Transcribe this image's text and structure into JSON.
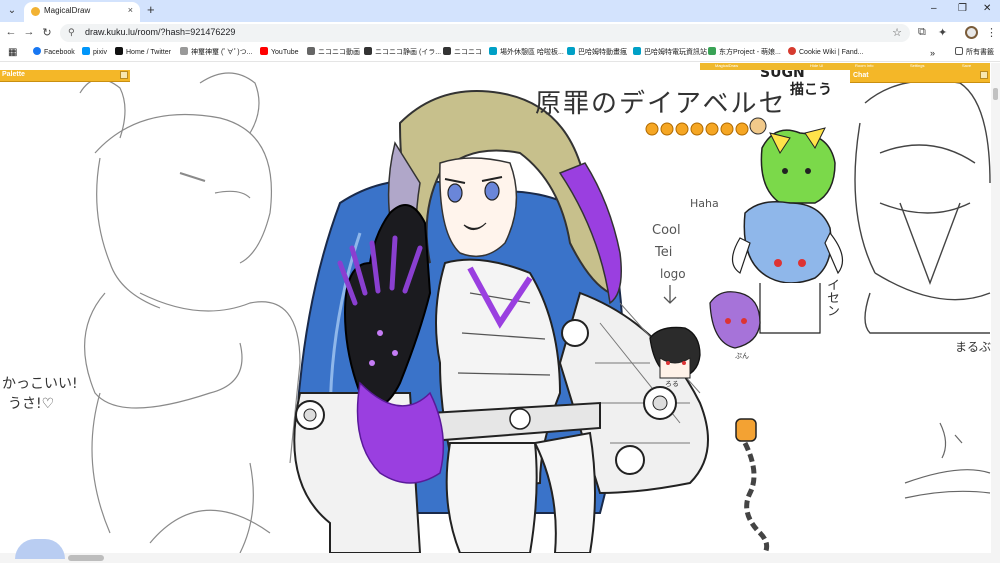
{
  "browser": {
    "tab_title": "MagicalDraw",
    "tab_close": "×",
    "new_tab": "+",
    "tab_menu": "⌄",
    "window_controls": {
      "minimize": "–",
      "maximize": "❐",
      "close": "✕"
    },
    "nav": {
      "back": "←",
      "forward": "→",
      "reload": "↻"
    },
    "site_info_icon": "⚲",
    "url": "draw.kuku.lu/room/?hash=921476229",
    "bookmark_star": "☆",
    "extensions": [
      "⧉",
      "✦",
      "⋮"
    ],
    "bookmarks": [
      {
        "icon": "facebook-icon",
        "label": "Facebook",
        "color": "#1877f2"
      },
      {
        "icon": "pixiv-icon",
        "label": "pixiv",
        "color": "#0096fa"
      },
      {
        "icon": "x-icon",
        "label": "Home / Twitter",
        "color": "#111111"
      },
      {
        "icon": "niconico-icon",
        "label": "神璽神璽 (ﾟ∀ﾟ)つ...",
        "color": "#888888"
      },
      {
        "icon": "youtube-icon",
        "label": "YouTube",
        "color": "#ff0000"
      },
      {
        "icon": "niconico-icon",
        "label": "ニコニコ動画",
        "color": "#555555"
      },
      {
        "icon": "niconico-icon",
        "label": "ニコニコ静画 (イラ...",
        "color": "#333333"
      },
      {
        "icon": "niconico-icon",
        "label": "ニコニコ",
        "color": "#333333"
      },
      {
        "icon": "bahamut-icon",
        "label": "場外休憩區 哈啦板...",
        "color": "#00a0c6"
      },
      {
        "icon": "bahamut-icon",
        "label": "巴哈姆特動畫瘋",
        "color": "#00a0c6"
      },
      {
        "icon": "bahamut-icon",
        "label": "巴哈姆特電玩資訊站",
        "color": "#00a0c6"
      },
      {
        "icon": "touhou-icon",
        "label": "东方Project - 萌娘...",
        "color": "#3aa356"
      },
      {
        "icon": "cookie-icon",
        "label": "Cookie Wiki | Fand...",
        "color": "#d63b2f"
      }
    ],
    "bookmarks_more": "»",
    "all_bookmarks": "所有書籤"
  },
  "app": {
    "palette_label": "Palette",
    "chat_label": "Chat",
    "top_strip_items": [
      "MagicalDraw",
      "Hide UI",
      "Room Info",
      "Settings",
      "Save"
    ]
  },
  "drawing_text": {
    "title_jp": "原罪のデイアベルセ",
    "sign": "SUGN",
    "sign_sub": "描こう",
    "haha": "Haha",
    "cool": "Cool",
    "tei": "Tei",
    "logo": "logo",
    "arrow": "↓",
    "side_jp": "イセン",
    "side_right": "まるぶ",
    "left_note_1": "かっこいい!",
    "left_note_2": "うさ!♡",
    "small_name": "ぷん",
    "small_note": "ろる"
  },
  "colors": {
    "tabstrip": "#d3e3fd",
    "panel_bar": "#f4b728",
    "hair": "#c7c08c",
    "purple": "#9a3fe0",
    "cloak_blue": "#3a73c9",
    "green_char": "#7bd94a"
  }
}
